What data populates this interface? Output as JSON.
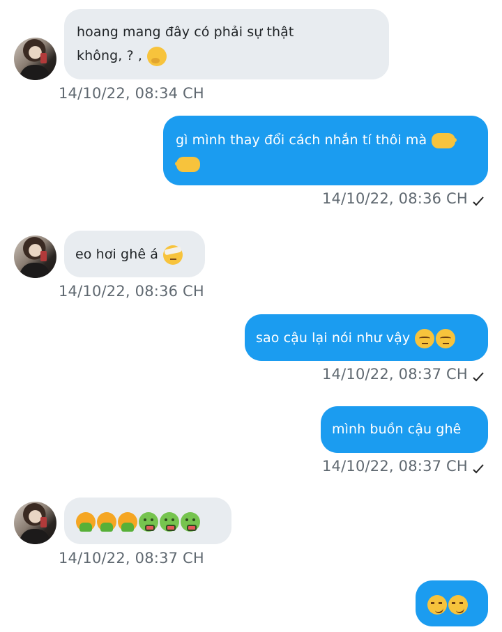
{
  "messages": [
    {
      "direction": "incoming",
      "text_line1": "hoang mang đây có phải sự thật",
      "text_line2": "không, ? ,",
      "emoji": [
        "thinking-face"
      ],
      "time": "14/10/22,  08:34 CH"
    },
    {
      "direction": "outgoing",
      "text_line1": "gì mình thay đổi cách nhắn tí thôi mà",
      "emoji": [
        "backhand-index-pointing-right",
        "backhand-index-pointing-left"
      ],
      "time": "14/10/22,  08:36 CH",
      "read": "✓"
    },
    {
      "direction": "incoming",
      "text": "eo hơi ghê á",
      "emoji": [
        "face-with-head-bandage"
      ],
      "time": "14/10/22,  08:36 CH"
    },
    {
      "direction": "outgoing",
      "text": "sao cậu lại nói như vậy",
      "emoji": [
        "pensive-face",
        "pensive-face"
      ],
      "time": "14/10/22,  08:37 CH",
      "read": "✓"
    },
    {
      "direction": "outgoing",
      "text": "mình buồn cậu ghê",
      "time": "14/10/22,  08:37 CH",
      "read": "✓"
    },
    {
      "direction": "incoming",
      "emoji": [
        "face-vomiting",
        "face-vomiting",
        "face-vomiting",
        "nauseated-face",
        "nauseated-face",
        "nauseated-face"
      ],
      "time": "14/10/22,  08:37 CH"
    },
    {
      "direction": "outgoing",
      "emoji": [
        "smirking-face",
        "smirking-face"
      ]
    }
  ],
  "colors": {
    "incoming_bubble": "#e8ecf0",
    "outgoing_bubble": "#1b9cf0",
    "timestamp": "#5f6870",
    "background": "#ffffff"
  }
}
